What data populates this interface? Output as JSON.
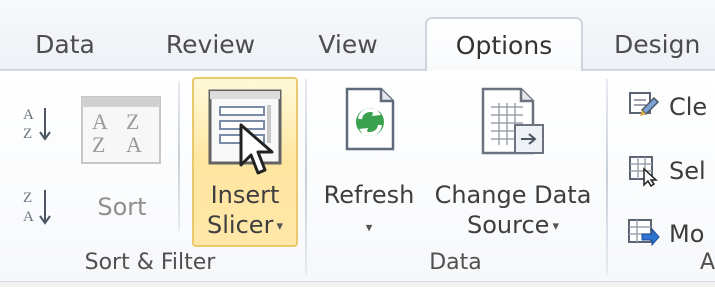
{
  "tabs": [
    {
      "label": "Data"
    },
    {
      "label": "Review"
    },
    {
      "label": "View"
    },
    {
      "label": "Options"
    },
    {
      "label": "Design"
    }
  ],
  "groups": {
    "sort_filter": {
      "label": "Sort & Filter",
      "sort_label": "Sort"
    },
    "slicer": {
      "line1": "Insert",
      "line2": "Slicer"
    },
    "data": {
      "label": "Data",
      "refresh_label": "Refresh",
      "change_line1": "Change Data",
      "change_line2": "Source"
    },
    "actions": {
      "clear_label": "Cle",
      "select_label": "Sel",
      "move_label": "Mo",
      "label": "A"
    }
  },
  "icons": {
    "sort_az": "sort-az-icon",
    "sort_za": "sort-za-icon",
    "sort_dialog": "sort-dialog-icon",
    "insert_slicer": "insert-slicer-icon",
    "cursor": "cursor-icon",
    "refresh": "refresh-icon",
    "change_data_source": "change-data-source-icon",
    "clear": "clear-icon",
    "select": "select-icon",
    "move": "move-pivot-icon"
  },
  "colors": {
    "hover_fill": "#ffe6a0",
    "hover_border": "#e8c96b",
    "tab_border": "#d0d4dc",
    "text": "#3e3e3e",
    "disabled": "#8f8f8f"
  }
}
